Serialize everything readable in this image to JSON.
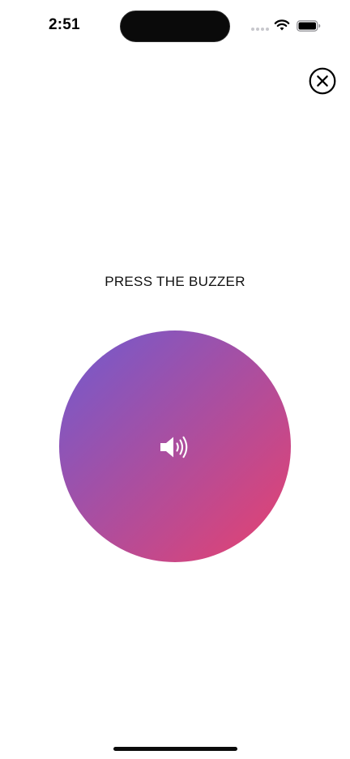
{
  "status_bar": {
    "time": "2:51",
    "icons": [
      "signal-icon",
      "wifi-icon",
      "battery-icon"
    ]
  },
  "close_button": {
    "icon": "close-circle-icon"
  },
  "main": {
    "prompt": "PRESS THE BUZZER",
    "buzzer": {
      "icon": "speaker-icon",
      "gradient_start": "#6f5bd0",
      "gradient_end": "#e8416e"
    }
  }
}
